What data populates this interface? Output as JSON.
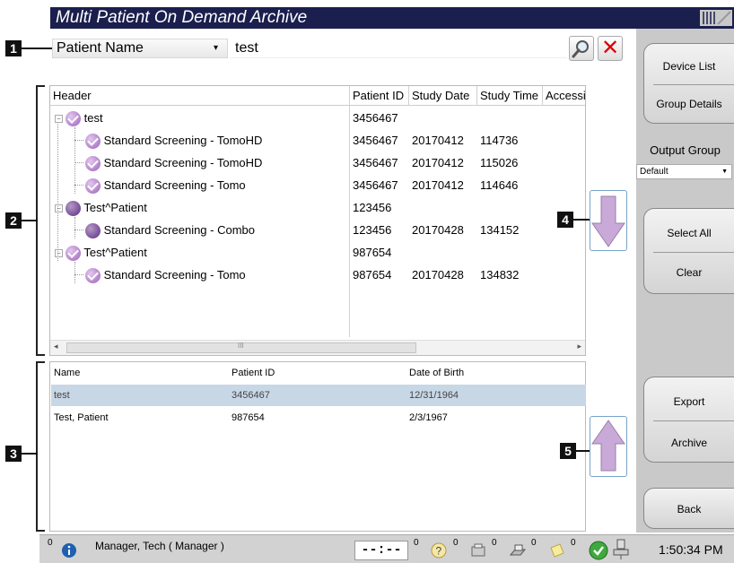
{
  "app": {
    "title": "Multi Patient On Demand Archive"
  },
  "callouts": {
    "c1": "1",
    "c2": "2",
    "c3": "3",
    "c4": "4",
    "c5": "5"
  },
  "search": {
    "field": "Patient Name",
    "value": "test"
  },
  "study_table": {
    "headers": [
      "Header",
      "Patient ID",
      "Study Date",
      "Study Time",
      "Accessi"
    ],
    "rows": [
      {
        "name": "test",
        "patient_id": "3456467",
        "study_date": "",
        "study_time": ""
      },
      {
        "name": "Standard Screening - TomoHD",
        "patient_id": "3456467",
        "study_date": "20170412",
        "study_time": "114736"
      },
      {
        "name": "Standard Screening - TomoHD",
        "patient_id": "3456467",
        "study_date": "20170412",
        "study_time": "115026"
      },
      {
        "name": "Standard Screening - Tomo",
        "patient_id": "3456467",
        "study_date": "20170412",
        "study_time": "114646"
      },
      {
        "name": "Test^Patient",
        "patient_id": "123456",
        "study_date": "",
        "study_time": ""
      },
      {
        "name": "Standard Screening - Combo",
        "patient_id": "123456",
        "study_date": "20170428",
        "study_time": "134152"
      },
      {
        "name": "Test^Patient",
        "patient_id": "987654",
        "study_date": "",
        "study_time": ""
      },
      {
        "name": "Standard Screening - Tomo",
        "patient_id": "987654",
        "study_date": "20170428",
        "study_time": "134832"
      }
    ],
    "scroll_center_mark": "III"
  },
  "patient_table": {
    "headers": [
      "Name",
      "Patient ID",
      "Date of Birth"
    ],
    "rows": [
      {
        "name": "test",
        "patient_id": "3456467",
        "dob": "12/31/1964"
      },
      {
        "name": "Test, Patient",
        "patient_id": "987654",
        "dob": "2/3/1967"
      }
    ]
  },
  "right_panel": {
    "device_list": "Device List",
    "group_details": "Group Details",
    "output_group_label": "Output Group",
    "output_group_value": "Default",
    "select_all": "Select All",
    "clear": "Clear",
    "export": "Export",
    "archive": "Archive",
    "back": "Back"
  },
  "status_bar": {
    "user": "Manager, Tech ( Manager )",
    "timer": "--:--",
    "counts": [
      "0",
      "0",
      "0",
      "0",
      "0",
      "0"
    ],
    "clock": "1:50:34 PM"
  },
  "colors": {
    "title_bg": "#1b1f4d",
    "accent_purple": "#9a5fb8",
    "selected_row": "#c8d7e6",
    "arrow": "#c9a9d8"
  }
}
